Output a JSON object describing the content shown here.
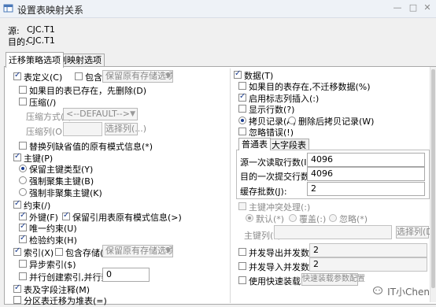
{
  "window": {
    "title": "设置表映射关系"
  },
  "source": {
    "label": "源:",
    "value": "CJC.T1"
  },
  "target": {
    "label": "目的:",
    "value": "CJC.T1"
  },
  "tabs": [
    "迁移策略选项",
    "列映射选项"
  ],
  "left": {
    "table_def": "表定义(C)",
    "include_storage": "包含存储(I)",
    "storage_combo": "保留原有存储选项",
    "drop_if_exists": "如果目的表已存在，先删除(D)",
    "compress": "压缩(/)",
    "compress_mode_label": "压缩方式(*):",
    "compress_mode_value": "<--DEFAULT-->",
    "compress_cols_label": "压缩列(O):",
    "choose_cols_button": "选择列(...)",
    "replace_default": "替换列缺省值的原有模式信息(*)",
    "primary_key": "主键(P)",
    "pk_options": [
      "保留主键类型(Y)",
      "强制聚集主键(B)",
      "强制非聚集主键(K)"
    ],
    "constraint": "约束(/)",
    "foreign_key": "外键(F)",
    "keep_ref_schema": "保留引用表原有模式信息(>)",
    "unique": "唯一约束(U)",
    "check": "检验约束(H)",
    "index": "索引(X)",
    "index_include_storage": "包含存储(~)",
    "index_storage_combo": "保留原有存储选项",
    "async_index": "异步索引($)",
    "parallel_index": "并行创建索引,并行数(Z):",
    "parallel_index_value": "0",
    "table_comments": "表及字段注释(M)",
    "partition_to_heap": "分区表迁移为堆表(=)"
  },
  "right": {
    "data": "数据(T)",
    "skip_if_data": "如果目的表存在,不迁移数据(%)",
    "enable_identity": "启用标志列插入(:)",
    "show_rows": "显示行数(?)",
    "copy_options": [
      "拷贝记录(A)",
      "删除后拷贝记录(W)"
    ],
    "ignore_errors": "忽略错误(!)",
    "inner_tabs": [
      "普通表",
      "大字段表"
    ],
    "read_rows_label": "源一次读取行数(I):",
    "read_rows_value": "4096",
    "commit_rows_label": "目的一次提交行数(Q):",
    "commit_rows_value": "4096",
    "cache_batches_label": "缓存批数(J):",
    "cache_batches_value": "2",
    "pk_conflict": "主键冲突处理(:)",
    "conflict_options": [
      "默认(*)",
      "覆盖(:)",
      "忽略(*)"
    ],
    "pk_cols_label": "主键列(*):",
    "choose_cols_button": "选择列(D)",
    "parallel_export_label": "并发导出并发数(#):",
    "parallel_export_value": "2",
    "parallel_import_label": "并发导入并发数(R):",
    "parallel_import_value": "2",
    "fast_load": "使用快速装载(+)",
    "fast_load_button": "快速装载参数配置"
  },
  "watermark": "IT小Chen"
}
